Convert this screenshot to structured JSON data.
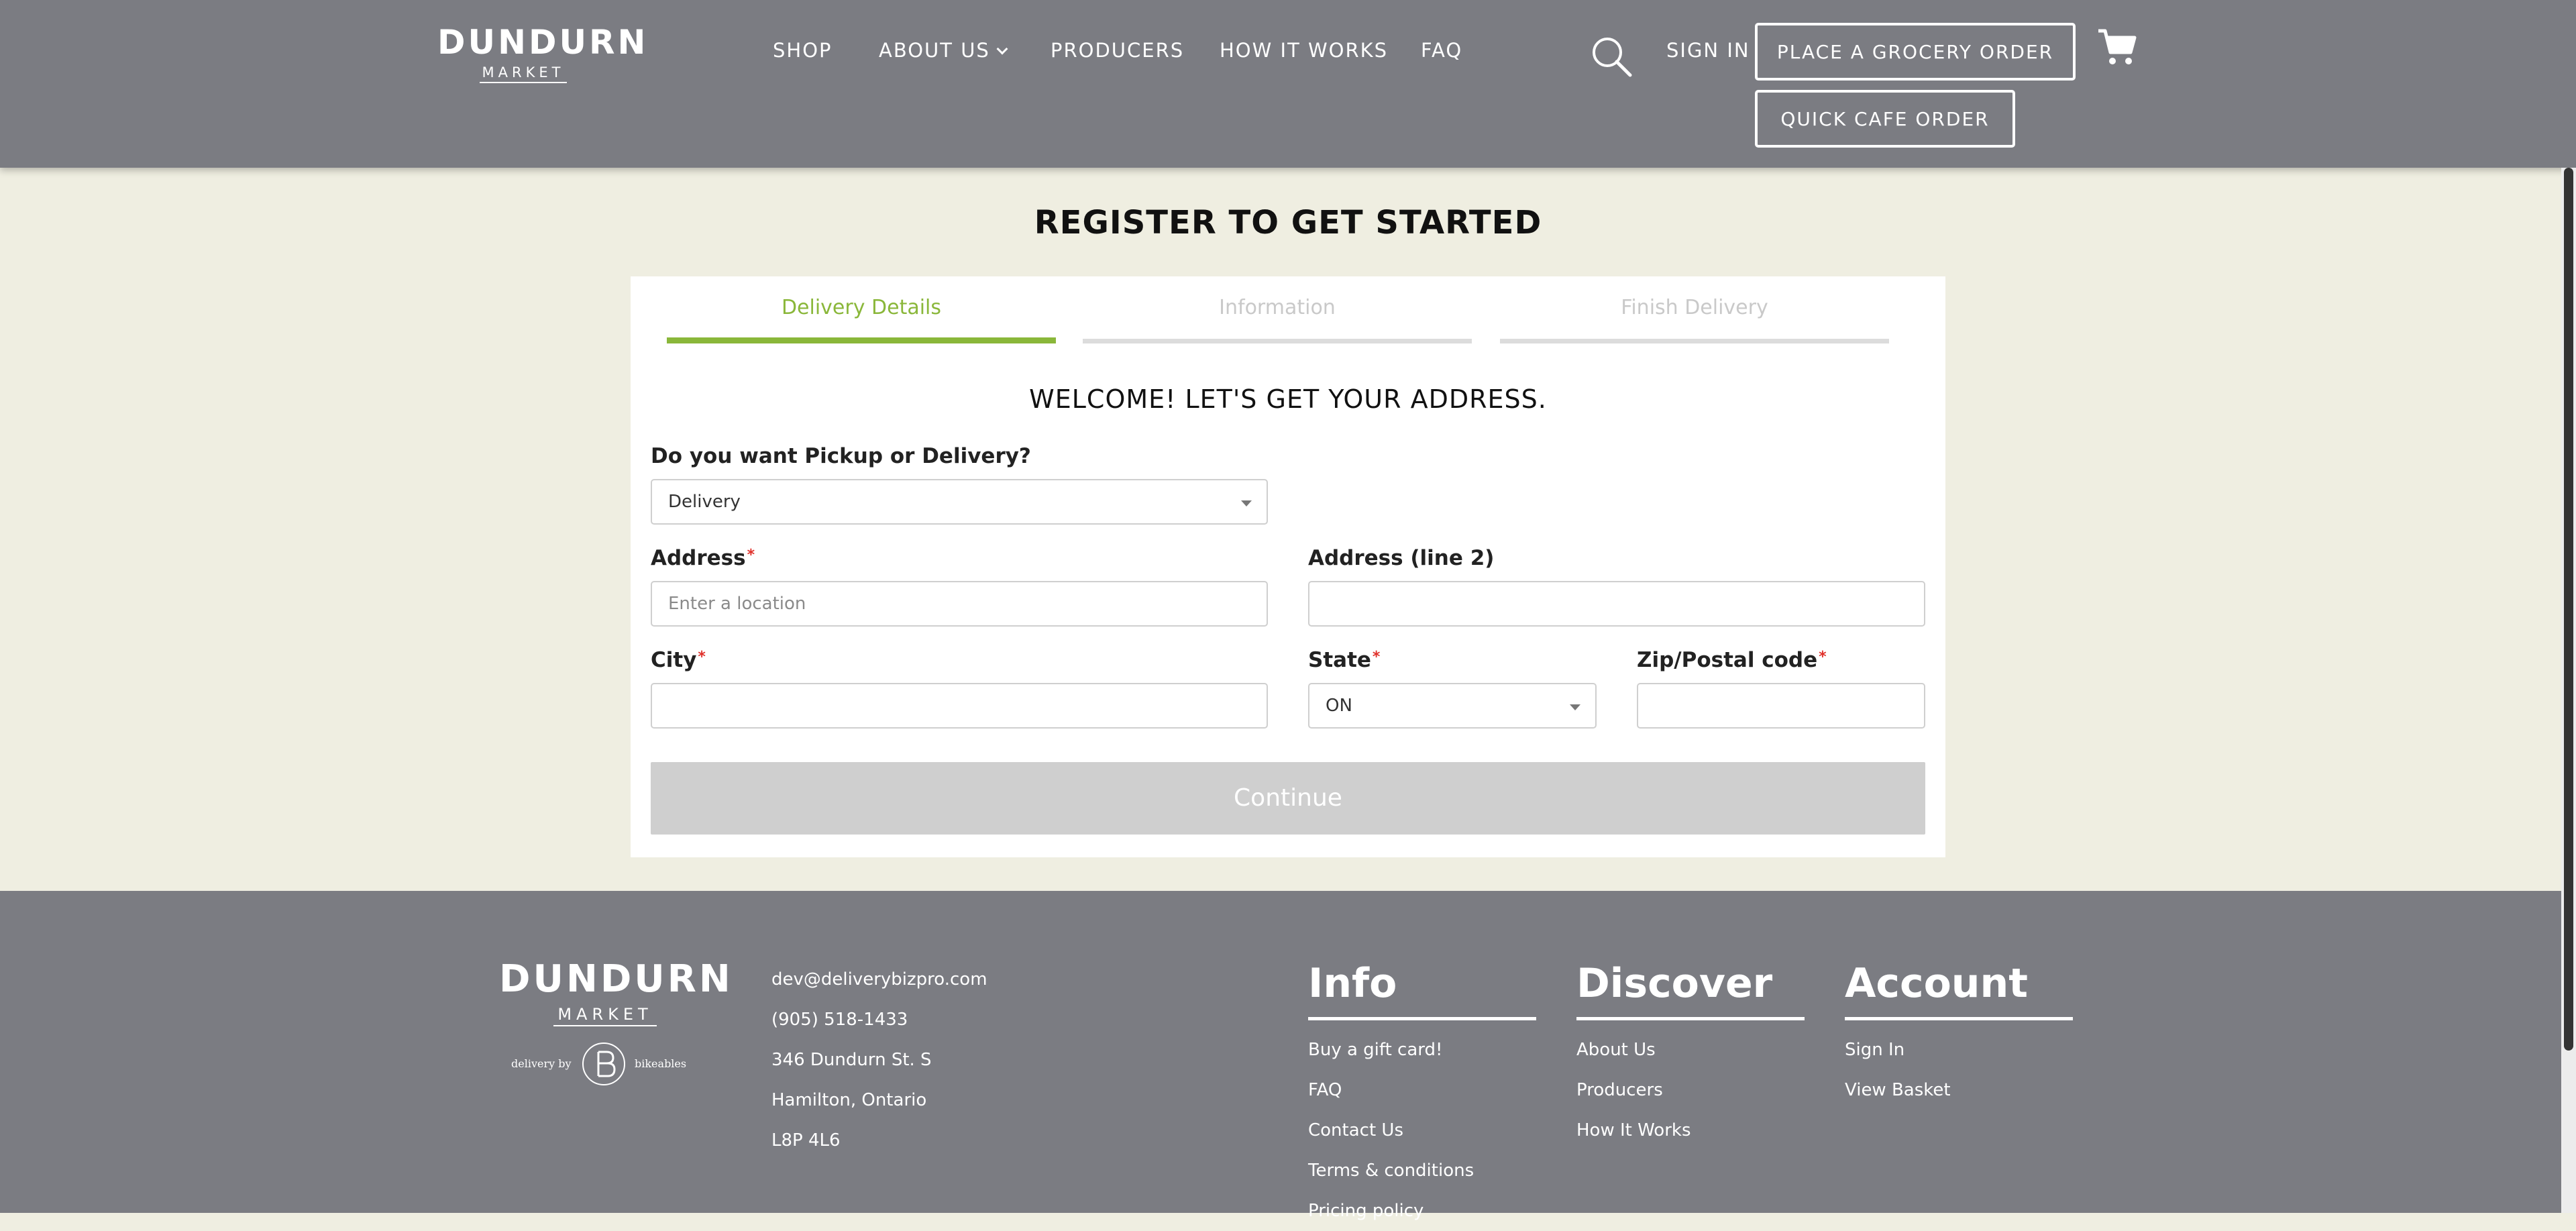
{
  "header": {
    "logo": {
      "brand": "DUNDURN",
      "sub": "MARKET"
    },
    "nav": [
      {
        "label": "SHOP"
      },
      {
        "label": "ABOUT US"
      },
      {
        "label": "PRODUCERS"
      },
      {
        "label": "HOW IT WORKS"
      },
      {
        "label": "FAQ"
      }
    ],
    "sign_in": "SIGN IN",
    "grocery_button": "PLACE A GROCERY ORDER",
    "cafe_button": "QUICK CAFE ORDER",
    "search_icon": "search-icon",
    "cart_icon": "cart-icon"
  },
  "main": {
    "title": "REGISTER TO GET STARTED",
    "steps": [
      {
        "label": "Delivery Details",
        "active": true
      },
      {
        "label": "Information",
        "active": false
      },
      {
        "label": "Finish Delivery",
        "active": false
      }
    ],
    "welcome": "WELCOME! LET'S GET YOUR ADDRESS.",
    "pickup_label": "Do you want Pickup or Delivery?",
    "pickup_value": "Delivery",
    "address_label": "Address",
    "address_placeholder": "Enter a location",
    "address2_label": "Address (line 2)",
    "address2_value": "",
    "city_label": "City",
    "city_value": "",
    "state_label": "State",
    "state_value": "ON",
    "zip_label": "Zip/Postal code",
    "zip_value": "",
    "required_mark": "*",
    "continue": "Continue"
  },
  "footer": {
    "logo": {
      "brand": "DUNDURN",
      "sub": "MARKET"
    },
    "delivery_by": {
      "prefix": "delivery by",
      "partner": "bikeables"
    },
    "contact": [
      "dev@deliverybizpro.com",
      "(905) 518-1433",
      "346 Dundurn St. S",
      "Hamilton, Ontario",
      "L8P 4L6"
    ],
    "columns": [
      {
        "title": "Info",
        "links": [
          "Buy a gift card!",
          "FAQ",
          "Contact Us",
          "Terms & conditions",
          "Pricing policy"
        ]
      },
      {
        "title": "Discover",
        "links": [
          "About Us",
          "Producers",
          "How It Works"
        ]
      },
      {
        "title": "Account",
        "links": [
          "Sign In",
          "View Basket"
        ]
      }
    ]
  },
  "colors": {
    "header_bg": "#7b7c82",
    "page_bg": "#efeee1",
    "accent": "#8ab73a",
    "required": "#e0312b",
    "button_disabled": "#cfcfcf"
  }
}
